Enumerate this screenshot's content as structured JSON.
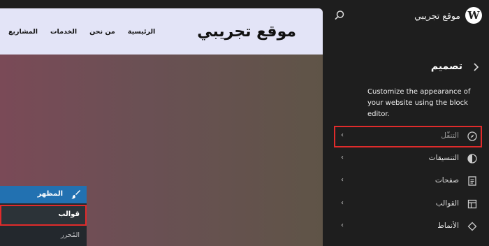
{
  "header": {
    "site_title": "موقع تجريبي",
    "logo_icon": "wordpress-logo-icon",
    "search_icon": "search-icon"
  },
  "panel": {
    "back_icon": "chevron-right-icon",
    "heading": "تصميم",
    "description": "Customize the appearance of your website using the block editor."
  },
  "nav": [
    {
      "label": "التنقّل",
      "icon": "compass-icon",
      "highlighted": true
    },
    {
      "label": "التنسيقات",
      "icon": "half-circle-icon"
    },
    {
      "label": "صفحات",
      "icon": "page-icon"
    },
    {
      "label": "القوالب",
      "icon": "layout-icon"
    },
    {
      "label": "الأنماط",
      "icon": "diamond-icon"
    }
  ],
  "preview": {
    "brand": "موقع تجريبي",
    "menu": [
      "الرئيسية",
      "من نحن",
      "الخدمات",
      "المشاريع"
    ],
    "colors": {
      "header_bg": "#e3e4f7",
      "gradient_start": "#7a4a57",
      "gradient_end": "#5f5447"
    }
  },
  "admin_menu": {
    "top_label": "المظهر",
    "top_icon": "paintbrush-icon",
    "items": [
      "قوالب",
      "المُحرر"
    ],
    "highlight_color": "#e02b2b",
    "accent_color": "#2271b1"
  }
}
